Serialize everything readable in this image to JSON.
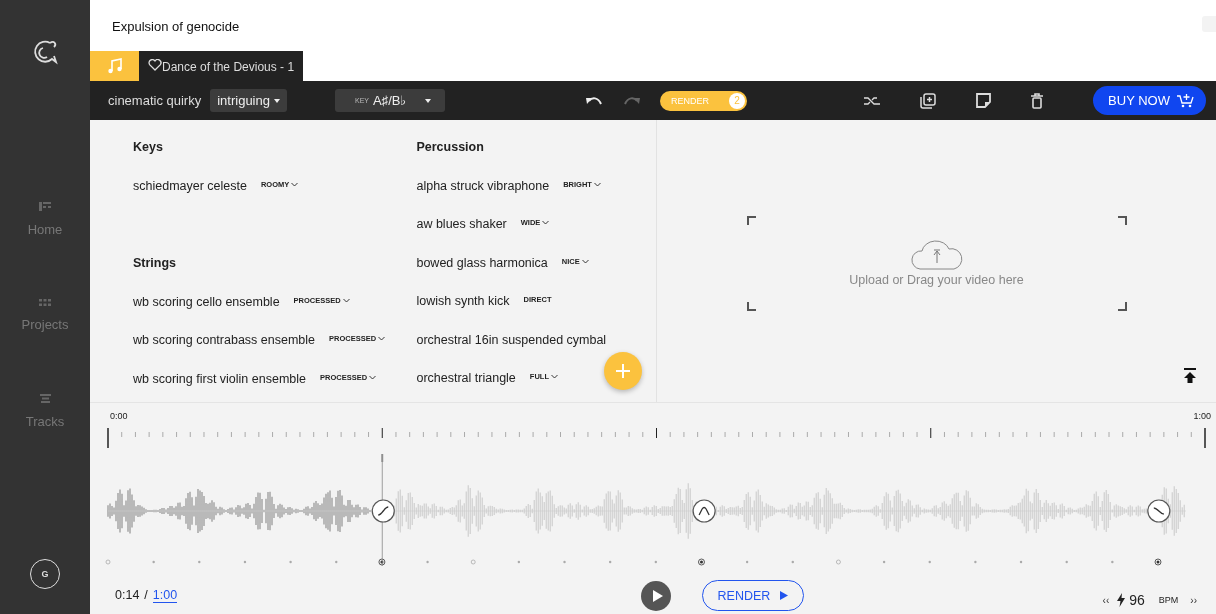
{
  "project": {
    "title": "Expulsion of genocide"
  },
  "tabs": [
    {
      "kind": "icon",
      "selected": false
    },
    {
      "kind": "track",
      "label": "Dance of the Devious - 1",
      "selected": true
    }
  ],
  "sidebar": {
    "items": [
      {
        "label": "Home",
        "kind": "home"
      },
      {
        "label": "Projects",
        "kind": "projects"
      },
      {
        "label": "Tracks",
        "kind": "tracks"
      }
    ],
    "avatar": "G"
  },
  "toolbar": {
    "style": "cinematic quirky",
    "mood": "intriguing",
    "key_label": "KEY",
    "key": "A♯/B♭",
    "undo_disabled": false,
    "redo_disabled": true,
    "render": {
      "label": "RENDER",
      "badge": "2"
    },
    "buy": "BUY NOW"
  },
  "instrument_columns": [
    {
      "sections": [
        {
          "title": "Keys",
          "instruments": [
            {
              "name": "schiedmayer celeste",
              "tag": "ROOMY",
              "dropdown": true
            }
          ]
        },
        {
          "title": "Strings",
          "instruments": [
            {
              "name": "wb scoring cello ensemble",
              "tag": "PROCESSED",
              "dropdown": true
            },
            {
              "name": "wb scoring contrabass ensemble",
              "tag": "PROCESSED",
              "dropdown": true
            },
            {
              "name": "wb scoring first violin ensemble",
              "tag": "PROCESSED",
              "dropdown": true
            }
          ]
        }
      ]
    },
    {
      "sections": [
        {
          "title": "Percussion",
          "instruments": [
            {
              "name": "alpha struck vibraphone",
              "tag": "BRIGHT",
              "dropdown": true
            },
            {
              "name": "aw blues shaker",
              "tag": "WIDE",
              "dropdown": true
            },
            {
              "name": "bowed glass harmonica",
              "tag": "NICE",
              "dropdown": true
            },
            {
              "name": "lowish synth kick",
              "tag": "DIRECT",
              "dropdown": false
            },
            {
              "name": "orchestral 16in suspended cymbal"
            },
            {
              "name": "orchestral triangle",
              "tag": "FULL",
              "dropdown": true
            }
          ]
        }
      ]
    }
  ],
  "video": {
    "hint": "Upload or Drag your video here"
  },
  "timeline": {
    "start": "0:00",
    "end": "1:00",
    "playhead": {
      "level": 0.25
    },
    "markers": [
      {
        "kind": "rise",
        "level": 0.25
      },
      {
        "kind": "peak",
        "level": 0.5425
      },
      {
        "kind": "fall",
        "level": 0.957
      }
    ]
  },
  "transport": {
    "current": "0:14",
    "separator": "/",
    "total": "1:00",
    "render": "RENDER",
    "tempo": "96",
    "tempo_unit": "BPM",
    "slower": "‹‹",
    "faster": "››"
  }
}
